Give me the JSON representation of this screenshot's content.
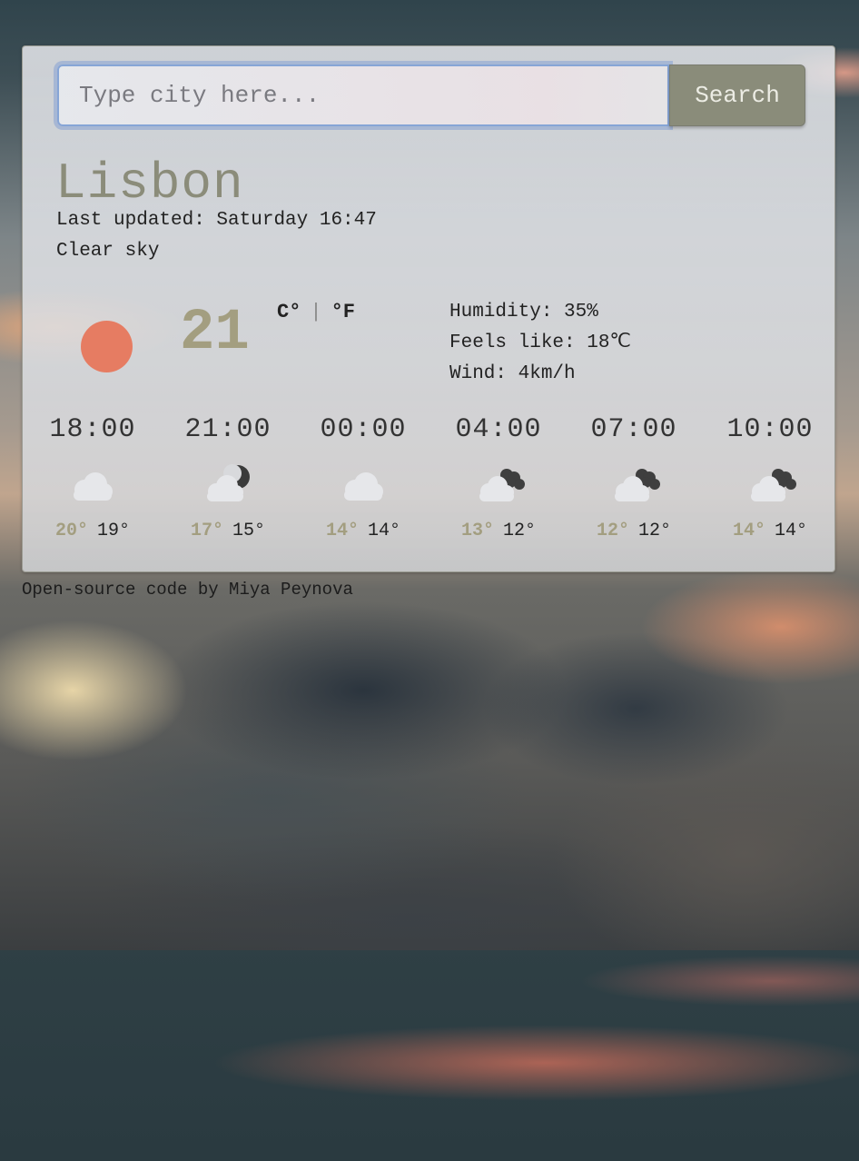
{
  "search": {
    "placeholder": "Type city here...",
    "button_label": "Search"
  },
  "current": {
    "city": "Lisbon",
    "last_updated": "Last updated: Saturday 16:47",
    "description": "Clear sky",
    "icon": "sun-icon",
    "temperature": "21",
    "unit_celsius": "C°",
    "unit_separator": "|",
    "unit_fahrenheit": "°F",
    "humidity": "Humidity: 35%",
    "feels_like": "Feels like: 18℃",
    "wind": "Wind: 4km/h"
  },
  "forecast": [
    {
      "time": "18:00",
      "icon": "cloud-icon",
      "max": "20°",
      "min": "19°"
    },
    {
      "time": "21:00",
      "icon": "cloud-night-icon",
      "max": "17°",
      "min": "15°"
    },
    {
      "time": "00:00",
      "icon": "cloud-icon",
      "max": "14°",
      "min": "14°"
    },
    {
      "time": "04:00",
      "icon": "broken-clouds-icon",
      "max": "13°",
      "min": "12°"
    },
    {
      "time": "07:00",
      "icon": "broken-clouds-icon",
      "max": "12°",
      "min": "12°"
    },
    {
      "time": "10:00",
      "icon": "broken-clouds-icon",
      "max": "14°",
      "min": "14°"
    }
  ],
  "footer": {
    "link_text": "Open-source code",
    "suffix": " by Miya Peynova"
  },
  "colors": {
    "accent": "#a39e80",
    "sun": "#e67c62",
    "button": "#8a8c7a"
  }
}
